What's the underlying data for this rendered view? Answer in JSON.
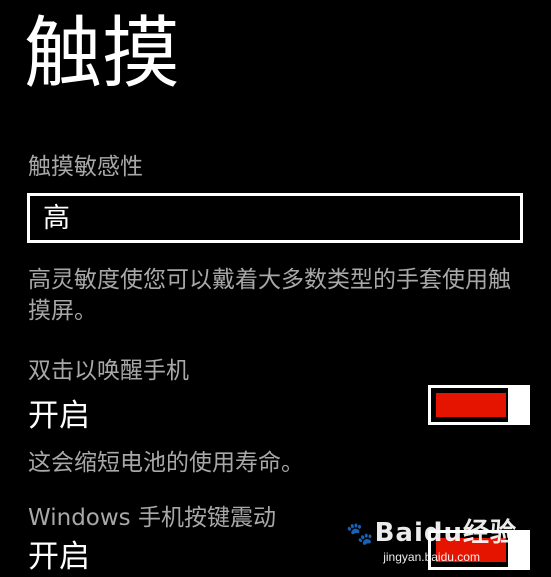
{
  "page": {
    "title": "触摸"
  },
  "sensitivity": {
    "label": "触摸敏感性",
    "value": "高",
    "description": "高灵敏度使您可以戴着大多数类型的手套使用触摸屏。"
  },
  "double_tap_wake": {
    "label": "双击以唤醒手机",
    "state_text": "开启",
    "toggle_on": true,
    "note": "这会缩短电池的使用寿命。"
  },
  "button_vibration": {
    "label": "Windows 手机按键震动",
    "state_text": "开启",
    "toggle_on": true
  },
  "watermark": {
    "logo_text": "Baidu经验",
    "url": "jingyan.baidu.com"
  },
  "colors": {
    "accent": "#e51400",
    "background": "#000000",
    "secondary_text": "#a8a8a8"
  },
  "icons": {
    "watermark_logo": "baidu-paw-icon"
  }
}
